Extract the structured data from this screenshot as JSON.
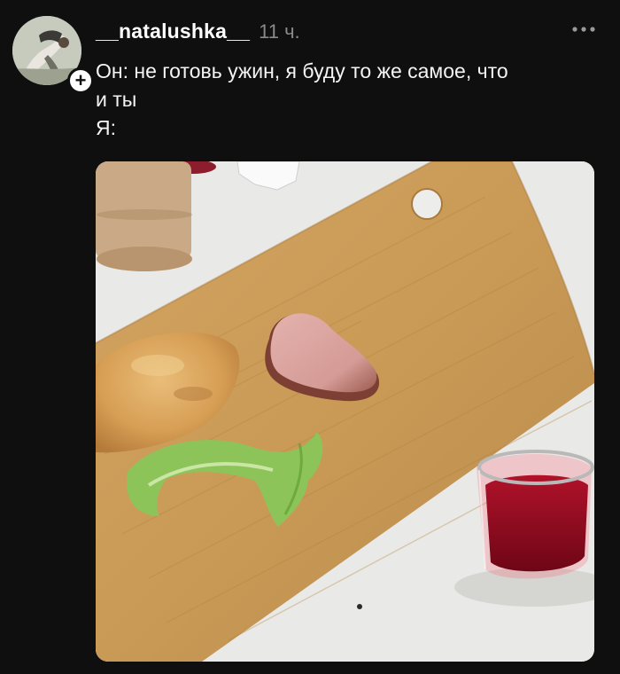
{
  "post": {
    "username": "__natalushka__",
    "timestamp": "11 ч.",
    "text_lines": [
      "Он: не готовь ужин, я буду то же самое, что",
      "и ты",
      "Я:"
    ]
  },
  "icons": {
    "more": "more-horizontal-icon",
    "follow": "plus-icon"
  },
  "colors": {
    "background": "#0f0f10",
    "text": "#f4f4f4",
    "muted": "#8a8a8d"
  }
}
